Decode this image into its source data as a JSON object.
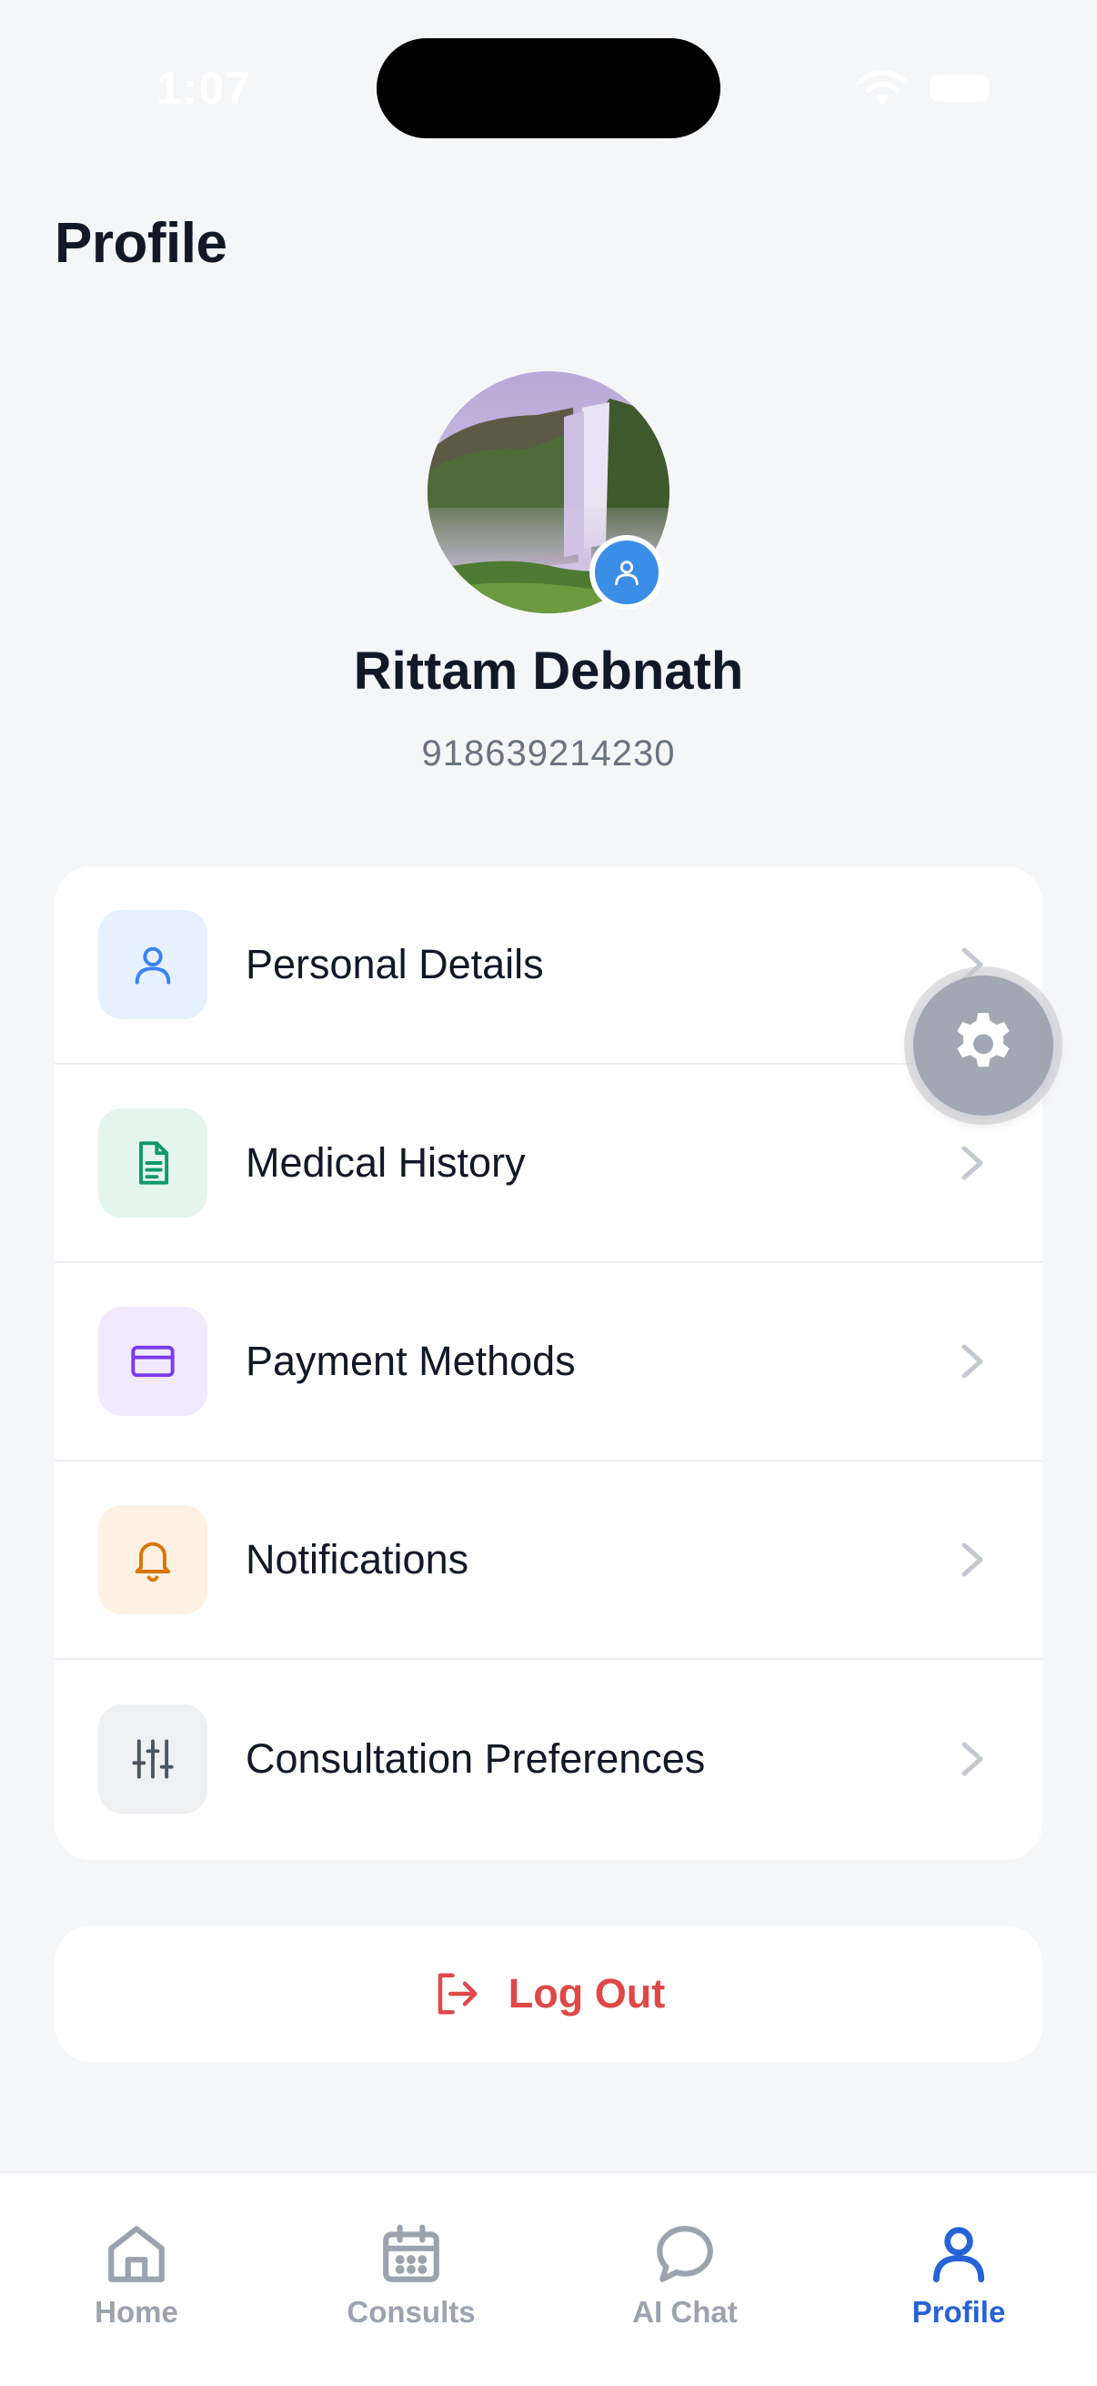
{
  "status_bar": {
    "time": "1:07"
  },
  "header": {
    "title": "Profile"
  },
  "profile": {
    "name": "Rittam Debnath",
    "phone": "918639214230"
  },
  "menu": {
    "items": [
      {
        "label": "Personal Details",
        "icon": "user-icon",
        "icon_color": "#3b82f6",
        "icon_bg": "#e6f1fd"
      },
      {
        "label": "Medical History",
        "icon": "document-icon",
        "icon_color": "#10976b",
        "icon_bg": "#e4f5ee"
      },
      {
        "label": "Payment Methods",
        "icon": "credit-card-icon",
        "icon_color": "#7c3aed",
        "icon_bg": "#f1eafe"
      },
      {
        "label": "Notifications",
        "icon": "bell-icon",
        "icon_color": "#d97706",
        "icon_bg": "#fcf1e3"
      },
      {
        "label": "Consultation Preferences",
        "icon": "sliders-icon",
        "icon_color": "#4b5563",
        "icon_bg": "#eff0f2"
      }
    ]
  },
  "logout": {
    "label": "Log Out",
    "color": "#e04848"
  },
  "tab_bar": {
    "active_color": "#2563d6",
    "inactive_color": "#9ca3af",
    "tabs": [
      {
        "label": "Home",
        "icon": "home-icon",
        "active": false
      },
      {
        "label": "Consults",
        "icon": "calendar-icon",
        "active": false
      },
      {
        "label": "AI Chat",
        "icon": "chat-bubble-icon",
        "active": false
      },
      {
        "label": "Profile",
        "icon": "user-icon",
        "active": true
      }
    ]
  }
}
